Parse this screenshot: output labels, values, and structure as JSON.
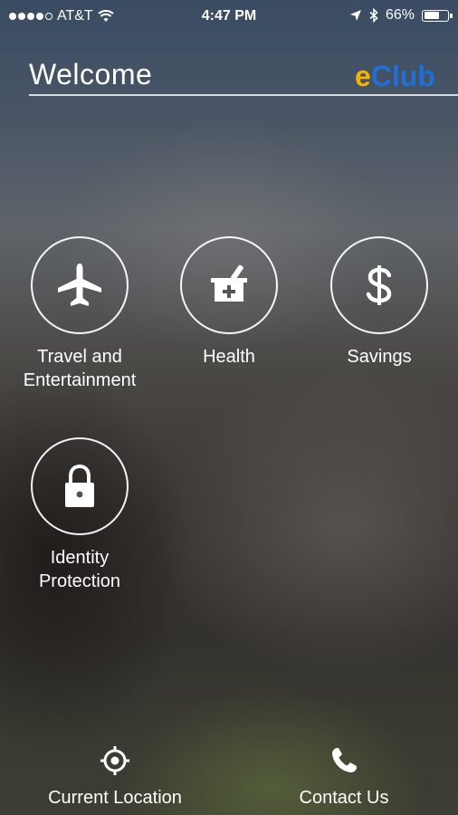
{
  "status_bar": {
    "carrier": "AT&T",
    "time": "4:47 PM",
    "battery": "66%",
    "battery_level": 0.66,
    "signal_bars_filled": 4
  },
  "header": {
    "title": "Welcome",
    "logo_e": "e",
    "logo_club": "Club"
  },
  "tiles": [
    {
      "label_line1": "Travel and",
      "label_line2": "Entertainment",
      "icon": "airplane-icon"
    },
    {
      "label": "Health",
      "icon": "mortar-pestle-icon"
    },
    {
      "label": "Savings",
      "icon": "dollar-icon"
    },
    {
      "label_line1": "Identity",
      "label_line2": "Protection",
      "icon": "lock-icon"
    }
  ],
  "bottom_bar": {
    "location_label": "Current Location",
    "contact_label": "Contact Us"
  },
  "colors": {
    "logo_e": "#f4b400",
    "logo_club": "#1e6fd6"
  }
}
